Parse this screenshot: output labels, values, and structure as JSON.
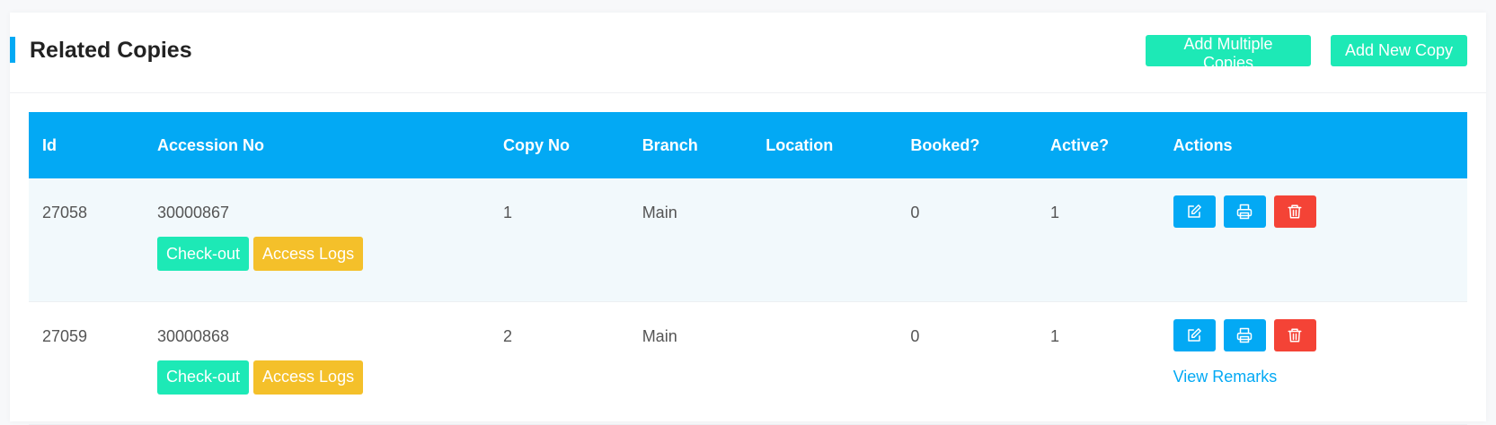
{
  "colors": {
    "accent": "#03a9f4",
    "teal": "#1de9b6",
    "amber": "#f4c02a",
    "red": "#f44336",
    "row_highlight": "#f2f9fc"
  },
  "header": {
    "title": "Related Copies",
    "add_multiple_label": "Add Multiple Copies",
    "add_new_label": "Add New Copy"
  },
  "table": {
    "columns": [
      "Id",
      "Accession No",
      "Copy No",
      "Branch",
      "Location",
      "Booked?",
      "Active?",
      "Actions"
    ],
    "rows": [
      {
        "id": "27058",
        "accession_no": "30000867",
        "copy_no": "1",
        "branch": "Main",
        "location": "",
        "booked": "0",
        "active": "1",
        "checkout_label": "Check-out",
        "access_logs_label": "Access Logs",
        "remarks_label": ""
      },
      {
        "id": "27059",
        "accession_no": "30000868",
        "copy_no": "2",
        "branch": "Main",
        "location": "",
        "booked": "0",
        "active": "1",
        "checkout_label": "Check-out",
        "access_logs_label": "Access Logs",
        "remarks_label": "View Remarks"
      }
    ],
    "action_icons": [
      "edit-icon",
      "print-icon",
      "trash-icon"
    ]
  }
}
